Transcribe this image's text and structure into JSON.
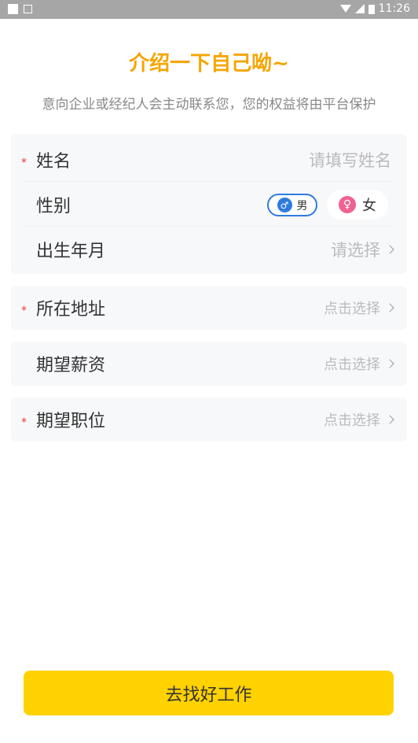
{
  "status_bar": {
    "time": "11:26"
  },
  "header": {
    "title": "介绍一下自己呦~",
    "subtitle": "意向企业或经纪人会主动联系您，您的权益将由平台保护"
  },
  "form": {
    "name": {
      "label": "姓名",
      "required_mark": "*",
      "placeholder": "请填写姓名"
    },
    "gender": {
      "label": "性别",
      "male": "男",
      "female": "女",
      "male_symbol": "♂",
      "female_symbol": "♀",
      "selected": "男"
    },
    "birth": {
      "label": "出生年月",
      "value": "请选择"
    },
    "address": {
      "label": "所在地址",
      "required_mark": "*",
      "value": "点击选择"
    },
    "salary": {
      "label": "期望薪资",
      "value": "点击选择"
    },
    "position": {
      "label": "期望职位",
      "required_mark": "*",
      "value": "点击选择"
    }
  },
  "submit": {
    "label": "去找好工作"
  },
  "colors": {
    "accent": "#f5a500",
    "button": "#ffd200",
    "required": "#e53935",
    "male": "#2e7be0",
    "female": "#f06292"
  }
}
